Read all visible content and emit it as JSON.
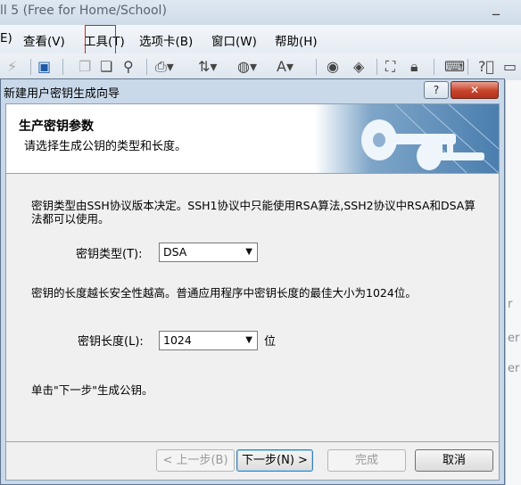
{
  "app": {
    "title": "ll 5 (Free for Home/School)",
    "minimize": "_"
  },
  "menubar": {
    "items": [
      "E)",
      "查看(V)",
      "工具(T)",
      "选项卡(B)",
      "窗口(W)",
      "帮助(H)"
    ]
  },
  "right_strip": [
    "r",
    "er",
    "er"
  ],
  "dialog": {
    "title": "新建用户密钥生成向导",
    "help_label": "?",
    "close_label": "✕",
    "banner": {
      "title": "生产密钥参数",
      "subtitle": "请选择生成公钥的类型和长度。"
    },
    "paragraph1": "密钥类型由SSH协议版本决定。SSH1协议中只能使用RSA算法,SSH2协议中RSA和DSA算法都可以使用。",
    "key_type_label": "密钥类型(T):",
    "key_type_value": "DSA",
    "paragraph2": "密钥的长度越长安全性越高。普通应用程序中密钥长度的最佳大小为1024位。",
    "key_length_label": "密钥长度(L):",
    "key_length_value": "1024",
    "key_length_unit": "位",
    "paragraph3": "单击\"下一步\"生成公钥。",
    "buttons": {
      "back": "< 上一步(B)",
      "next": "下一步(N) >",
      "finish": "完成",
      "cancel": "取消"
    }
  }
}
